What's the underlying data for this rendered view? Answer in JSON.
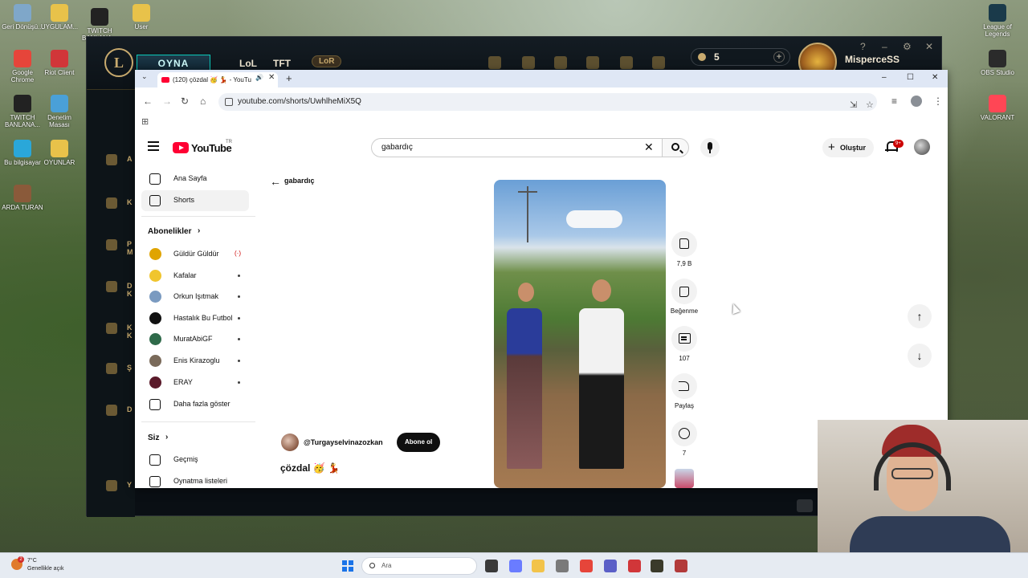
{
  "desktop": {
    "icons_left": [
      {
        "label": "Geri Dönüşü...",
        "icon": "recycle-bin-icon",
        "color": "#7fa7c9"
      },
      {
        "label": "UYGULAM...",
        "icon": "folder-icon",
        "color": "#e8c24a"
      },
      {
        "label": "TWITCH BANLANA...",
        "icon": "twitch-icon",
        "color": "#222222"
      },
      {
        "label": "User",
        "icon": "folder-icon",
        "color": "#e8c24a"
      },
      {
        "label": "Google Chrome",
        "icon": "chrome-icon",
        "color": "#e6453a"
      },
      {
        "label": "Riot Client",
        "icon": "riot-icon",
        "color": "#d13639"
      },
      {
        "label": "TWITCH BANLANA...",
        "icon": "twitch-icon",
        "color": "#222222"
      },
      {
        "label": "Denetim Masası",
        "icon": "control-panel-icon",
        "color": "#4aa0d8"
      },
      {
        "label": "Bu bilgisayar",
        "icon": "computer-icon",
        "color": "#2aa7d9"
      },
      {
        "label": "OYUNLAR",
        "icon": "folder-icon",
        "color": "#e8c24a"
      },
      {
        "label": "ARDA TURAN",
        "icon": "image-icon",
        "color": "#8a5a3a"
      }
    ],
    "icons_right": [
      {
        "label": "League of Legends",
        "icon": "lol-icon",
        "color": "#1a3a4a"
      },
      {
        "label": "OBS Studio",
        "icon": "obs-icon",
        "color": "#2b2b2b"
      },
      {
        "label": "VALORANT",
        "icon": "valorant-icon",
        "color": "#ff4655"
      }
    ]
  },
  "lol_client": {
    "play_label": "OYNA",
    "nav": [
      "LoL",
      "TFT"
    ],
    "lor_label": "LoR",
    "currency_value": "5",
    "summoner_name": "MisperceSS",
    "sidebar_letters": [
      "A",
      "K",
      "P\nM",
      "D\nK",
      "K\nK",
      "Ş",
      "D",
      "Y"
    ]
  },
  "browser": {
    "tab_title": "(120) çözdal 🥳 💃 - YouTu",
    "url": "youtube.com/shorts/UwhlheMiX5Q",
    "window_controls": [
      "–",
      "☐",
      "✕"
    ]
  },
  "youtube": {
    "logo_text": "YouTube",
    "country_code": "TR",
    "search_value": "gabardıç",
    "create_label": "Oluştur",
    "notification_count": "9+",
    "sidebar": {
      "main": [
        {
          "label": "Ana Sayfa",
          "icon": "home-icon",
          "active": false
        },
        {
          "label": "Shorts",
          "icon": "shorts-icon",
          "active": true
        }
      ],
      "subscriptions_title": "Abonelikler",
      "subscriptions": [
        {
          "label": "Güldür Güldür",
          "color": "#e0a400",
          "live": true
        },
        {
          "label": "Kafalar",
          "color": "#f0c52e",
          "live": false
        },
        {
          "label": "Orkun Işıtmak",
          "color": "#7a9ac0",
          "live": false
        },
        {
          "label": "Hastalık Bu Futbol",
          "color": "#111111",
          "live": false
        },
        {
          "label": "MuratAbiGF",
          "color": "#2f6a4a",
          "live": false
        },
        {
          "label": "Enis Kirazoglu",
          "color": "#7a6a5a",
          "live": false
        },
        {
          "label": "ERAY",
          "color": "#5a1a2a",
          "live": false
        }
      ],
      "show_more_label": "Daha fazla göster",
      "you_title": "Siz",
      "you_items": [
        {
          "label": "Geçmiş",
          "icon": "history-icon"
        },
        {
          "label": "Oynatma listeleri",
          "icon": "playlists-icon"
        }
      ]
    },
    "back_query": "gabardıç",
    "short": {
      "channel_handle": "@Turgayselvinazozkan",
      "subscribe_label": "Abone ol",
      "title": "çözdal 🥳 💃",
      "like_count": "7,9 B",
      "dislike_label": "Beğenme",
      "comment_count": "107",
      "share_label": "Paylaş",
      "remix_count": "7"
    }
  },
  "taskbar": {
    "weather_temp": "7°C",
    "weather_desc": "Genellikle açık",
    "weather_badge": "2",
    "search_placeholder": "Ara",
    "apps": [
      {
        "icon": "task-view-icon",
        "color": "#3a3a3a"
      },
      {
        "icon": "copilot-icon",
        "color": "#6a7cff"
      },
      {
        "icon": "file-explorer-icon",
        "color": "#f2c34a"
      },
      {
        "icon": "edge-icon",
        "color": "#7a7a7a"
      },
      {
        "icon": "chrome-icon",
        "color": "#e6453a"
      },
      {
        "icon": "teams-icon",
        "color": "#5b5fc7"
      },
      {
        "icon": "riot-icon",
        "color": "#d13639"
      },
      {
        "icon": "lol-icon",
        "color": "#3a3a2a"
      },
      {
        "icon": "obs-icon",
        "color": "#b23a3a"
      }
    ]
  }
}
